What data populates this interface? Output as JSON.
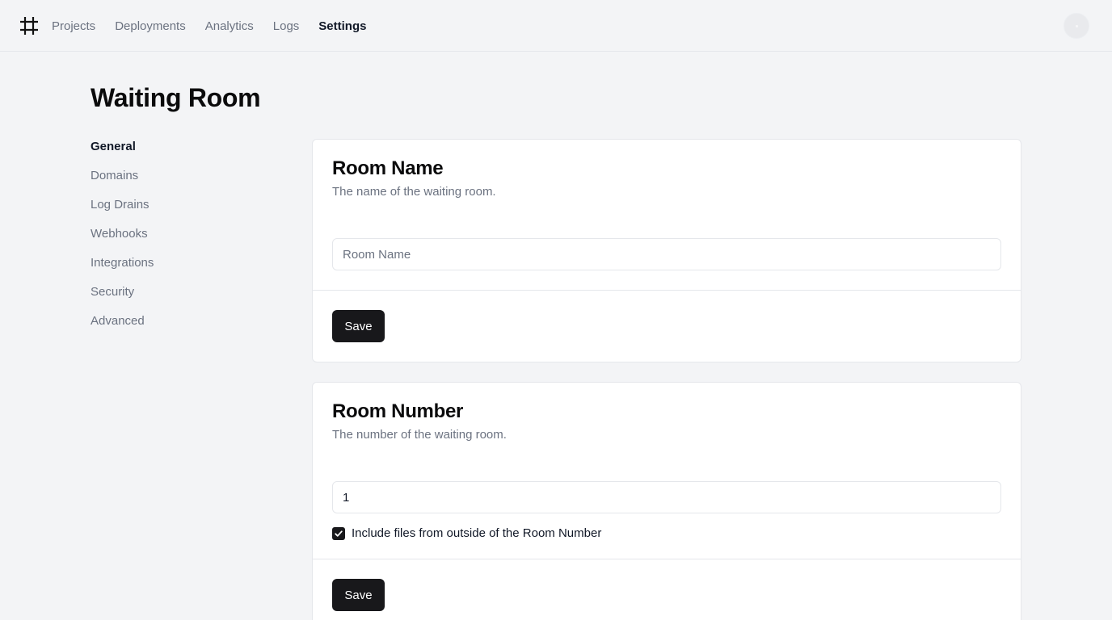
{
  "app": {
    "logo_icon": "hash-icon"
  },
  "nav": {
    "items": [
      {
        "label": "Projects",
        "active": false
      },
      {
        "label": "Deployments",
        "active": false
      },
      {
        "label": "Analytics",
        "active": false
      },
      {
        "label": "Logs",
        "active": false
      },
      {
        "label": "Settings",
        "active": true
      }
    ]
  },
  "page": {
    "title": "Waiting Room"
  },
  "sidebar": {
    "items": [
      {
        "label": "General",
        "active": true
      },
      {
        "label": "Domains",
        "active": false
      },
      {
        "label": "Log Drains",
        "active": false
      },
      {
        "label": "Webhooks",
        "active": false
      },
      {
        "label": "Integrations",
        "active": false
      },
      {
        "label": "Security",
        "active": false
      },
      {
        "label": "Advanced",
        "active": false
      }
    ]
  },
  "room_name_card": {
    "title": "Room Name",
    "description": "The name of the waiting room.",
    "input_value": "",
    "input_placeholder": "Room Name",
    "save_label": "Save"
  },
  "room_number_card": {
    "title": "Room Number",
    "description": "The number of the waiting room.",
    "input_value": "1",
    "checkbox_checked": true,
    "checkbox_label": "Include files from outside of the Room Number",
    "save_label": "Save"
  },
  "colors": {
    "background": "#f3f4f6",
    "primary_button": "#18181b",
    "muted_text": "#6b7280"
  }
}
